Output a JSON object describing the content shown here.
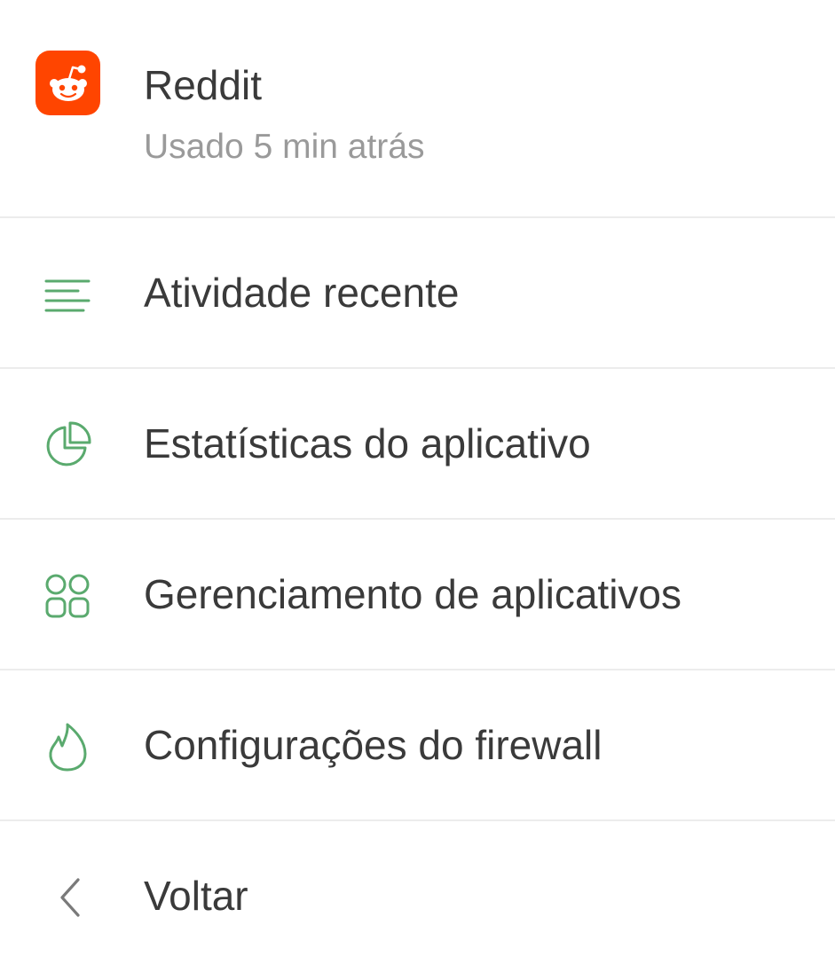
{
  "app": {
    "name": "Reddit",
    "meta": "Usado 5 min atrás",
    "icon": "reddit-logo-icon",
    "brand_color": "#ff4500"
  },
  "accent_color": "#5aaa6e",
  "menu": [
    {
      "label": "Atividade recente",
      "icon": "list-lines-icon"
    },
    {
      "label": "Estatísticas do aplicativo",
      "icon": "pie-chart-icon"
    },
    {
      "label": "Gerenciamento de aplicativos",
      "icon": "app-grid-icon"
    },
    {
      "label": "Configurações do firewall",
      "icon": "flame-icon"
    },
    {
      "label": "Voltar",
      "icon": "chevron-left-icon"
    }
  ]
}
